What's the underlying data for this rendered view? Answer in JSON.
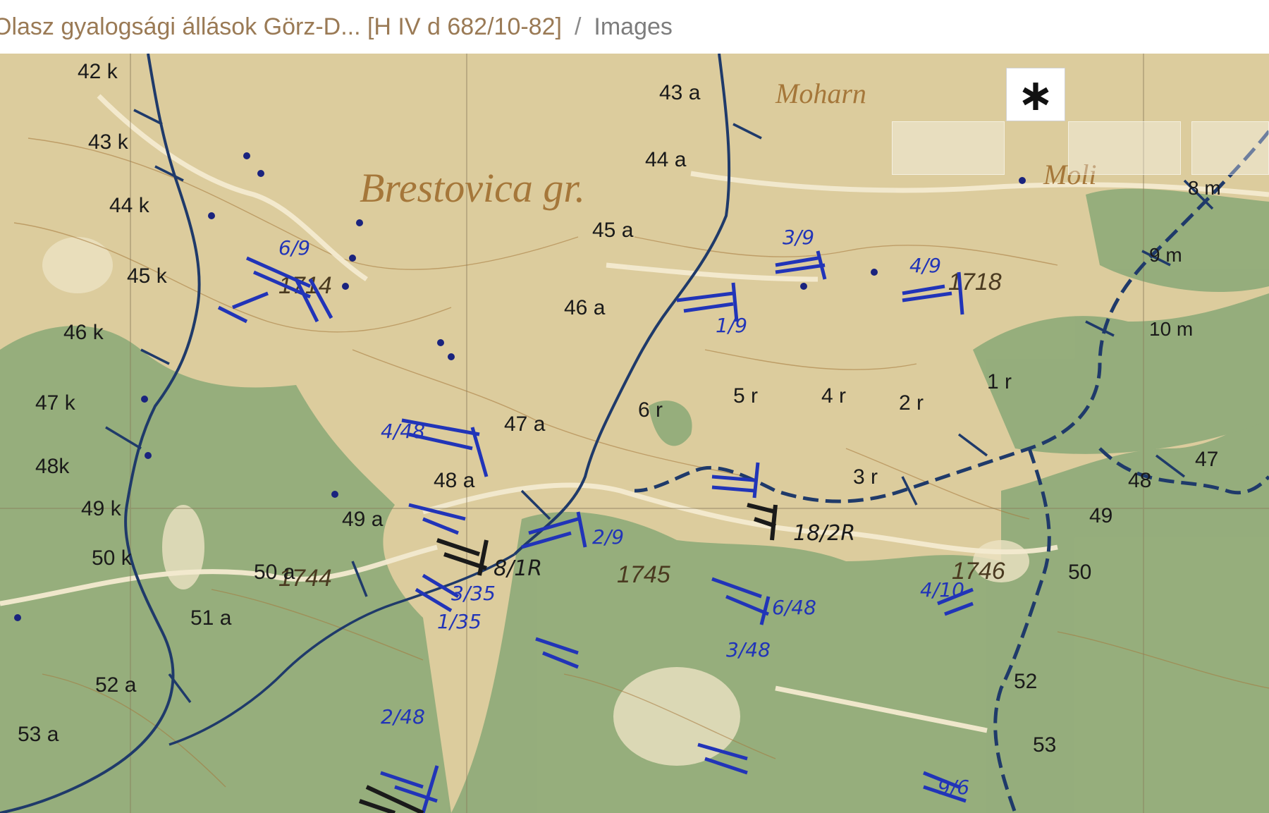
{
  "breadcrumb": {
    "parent_label": "Olasz gyalogsági állások Görz-D... [H IV d 682/10-82]",
    "separator": "/",
    "current_label": "Images"
  },
  "toolbar": {
    "asterisk_label": "∗"
  },
  "map": {
    "place_labels": {
      "brestovica": "Brestovica gr.",
      "mohar": "Moharn",
      "moli": "Moli"
    },
    "heights": [
      "1744",
      "1745",
      "1746",
      "1714",
      "1718"
    ],
    "k_labels": [
      "42 k",
      "43 k",
      "44 k",
      "45 k",
      "46 k",
      "47 k",
      "48k",
      "49 k",
      "50 k"
    ],
    "a_labels": [
      "43 a",
      "44 a",
      "45 a",
      "46 a",
      "47 a",
      "48 a",
      "49 a",
      "50 a",
      "51 a",
      "52 a",
      "53 a"
    ],
    "r_labels": [
      "6 r",
      "5 r",
      "4 r",
      "3 r",
      "2 r",
      "1 r"
    ],
    "m_labels": [
      "8 m",
      "9 m",
      "10 m"
    ],
    "numbers": [
      "47",
      "48",
      "49",
      "50",
      "52",
      "53"
    ],
    "unit_marks": [
      "6/9",
      "2/9",
      "1/9",
      "3/9",
      "4/9",
      "4/48",
      "3/48",
      "6/48",
      "2/48",
      "18/2R",
      "8/1R",
      "3/35",
      "1/35",
      "4/10",
      "9/6"
    ],
    "colors": {
      "paper": "#d9c99a",
      "forest": "#8fab7a",
      "contour": "#a5773a",
      "blue_ink": "#2134b8",
      "black_ink": "#1a1a1a",
      "route": "#1f3a6a"
    }
  }
}
